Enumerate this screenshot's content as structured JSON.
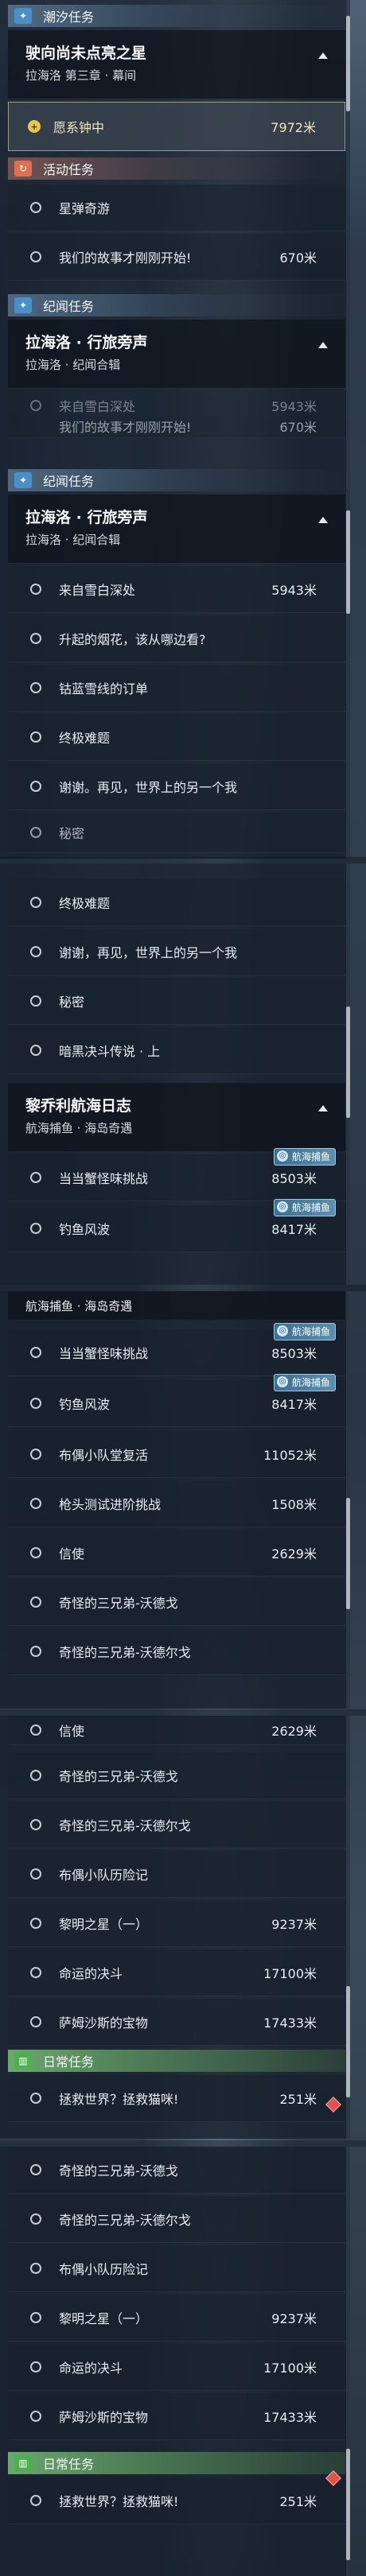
{
  "categories": {
    "chaoxi": "潮汐任务",
    "activity": "活动任务",
    "jiwen": "纪闻任务",
    "daily": "日常任务"
  },
  "missions": {
    "main": {
      "title": "驶向尚未点亮之星",
      "sub": "拉海洛 第三章 · 幕间"
    },
    "lahailuo": {
      "title": "拉海洛 · 行旅旁声",
      "sub": "拉海洛 · 纪闻合辑"
    },
    "liqiao": {
      "title": "黎乔利航海日志",
      "sub": "航海捕鱼 · 海岛奇遇"
    }
  },
  "tracking": {
    "label": "愿系钟中",
    "dist": "7972米"
  },
  "items": {
    "xingdan": "星弹奇游",
    "gushi": "我们的故事才刚刚开始!",
    "gushi_dist": "670米",
    "xuebai": "来自雪白深处",
    "yanhua": "升起的烟花，该从哪边看?",
    "gulan": "钴蓝雪线的订单",
    "zhongji": "终极难题",
    "xiexie": "谢谢。再见，世界上的另一个我",
    "mimi": "秘密",
    "anhei": "暗黑决斗传说 · 上",
    "xiexie_short": "谢谢，再见，世界上的另一个我",
    "pangxie": "当当蟹怪味挑战",
    "diaoyu": "钓鱼风波",
    "bubu": "布偶小队堂复活",
    "qiangtou": "枪头测试进阶挑战",
    "xinshi": "信使",
    "qiguai_ge": "奇怪的三兄弟-沃德戈",
    "qiguai_er": "奇怪的三兄弟-沃德尔戈",
    "bubu_li": "布偶小队历险记",
    "liming": "黎明之星（一）",
    "mingyun": "命运的决斗",
    "samu": "萨姆沙斯的宝物",
    "zhengjiu": "拯救世界？拯救猫咪!"
  },
  "dist": {
    "xuebai": "5943米",
    "pangxie": "8503米",
    "diaoyu": "8417米",
    "bubu": "11052米",
    "qiangtou": "1508米",
    "xinshi": "2629米",
    "liming": "9237米",
    "mingyun": "17100米",
    "samu": "17433米",
    "zhengjiu": "251米",
    "cut_top": "5943米"
  },
  "badge": "航海捕鱼",
  "cut_text": "我们的故事才刚刚开始!",
  "cut_text2": "来自雪白深处"
}
